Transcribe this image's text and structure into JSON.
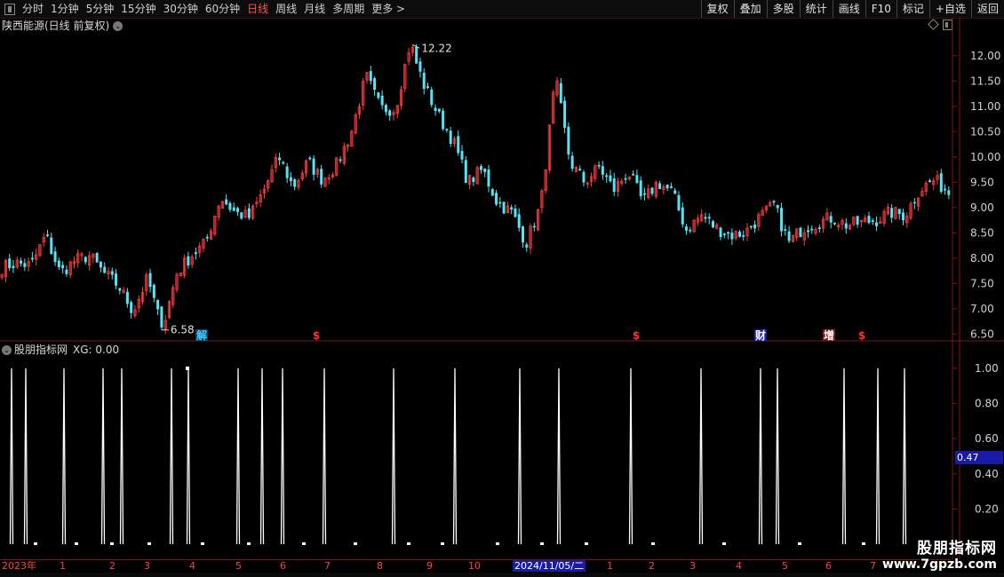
{
  "toolbar": {
    "periods": [
      "分时",
      "1分钟",
      "5分钟",
      "15分钟",
      "30分钟",
      "60分钟",
      "日线",
      "周线",
      "月线",
      "多周期",
      "更多 >"
    ],
    "active_index": 6,
    "right_buttons": [
      "复权",
      "叠加",
      "多股",
      "统计",
      "画线",
      "F10",
      "标记",
      "+自选",
      "返回"
    ]
  },
  "main": {
    "title": "陕西能源(日线 前复权)",
    "high_label": "12.22",
    "low_label": "6.58",
    "y_ticks": [
      "12.00",
      "11.50",
      "11.00",
      "10.50",
      "10.00",
      "9.50",
      "9.00",
      "8.50",
      "8.00",
      "7.50",
      "7.00",
      "6.50"
    ],
    "markers": [
      {
        "text": "解",
        "color": "#40c8ff",
        "bg": "#104060"
      },
      {
        "text": "$",
        "color": "#ff3030",
        "bg": ""
      },
      {
        "text": "$",
        "color": "#ff3030",
        "bg": ""
      },
      {
        "text": "财",
        "color": "#ffffff",
        "bg": "#1a1aa8"
      },
      {
        "text": "增",
        "color": "#ffffff",
        "bg": "#801818"
      },
      {
        "text": "$",
        "color": "#ff3030",
        "bg": ""
      }
    ],
    "colors": {
      "up": "#ff3c3c",
      "down": "#54e4f4",
      "axis": "#8a1010"
    }
  },
  "chart_data": [
    {
      "type": "candlestick",
      "title": "陕西能源(日线 前复权)",
      "ylim": [
        6.4,
        12.4
      ],
      "annotations": {
        "high": 12.22,
        "low": 6.58
      },
      "close_path": [
        7.82,
        7.9,
        7.85,
        8.45,
        7.7,
        7.95,
        8.05,
        7.7,
        7.45,
        6.95,
        7.6,
        6.58,
        7.7,
        8.05,
        8.3,
        9.2,
        8.9,
        8.8,
        9.35,
        10.0,
        9.4,
        9.9,
        9.55,
        9.85,
        10.5,
        11.6,
        10.95,
        10.95,
        12.22,
        11.4,
        10.8,
        10.3,
        9.5,
        9.75,
        9.1,
        8.9,
        8.3,
        9.05,
        11.55,
        9.9,
        9.5,
        9.8,
        9.35,
        9.7,
        9.1,
        9.5,
        9.3,
        8.55,
        8.85,
        8.6,
        8.45,
        8.5,
        8.8,
        9.05,
        8.3,
        8.6,
        8.7,
        8.8,
        8.65,
        8.7,
        8.75,
        8.9,
        8.85,
        9.35,
        9.55,
        9.3
      ]
    },
    {
      "type": "line",
      "title": "股朋指标网 XG",
      "ylim": [
        0,
        1.05
      ],
      "current_value": 0.0,
      "cursor_value": 0.47,
      "spike_count": 33,
      "baseline": 0.0,
      "peak": 1.0
    }
  ],
  "sub": {
    "title": "股朋指标网",
    "xg_text": "XG: 0.00",
    "y_ticks": [
      "1.00",
      "0.80",
      "0.60",
      "0.40",
      "0.20"
    ],
    "cursor_value": "0.47"
  },
  "date_axis": {
    "ticks": [
      "2023年",
      "1",
      "2",
      "3",
      "4",
      "5",
      "6",
      "7",
      "8",
      "9",
      "10",
      "1",
      "2",
      "3",
      "4",
      "5",
      "6",
      "7"
    ],
    "cursor_date": "2024/11/05/二"
  },
  "watermark": {
    "title": "股朋指标网",
    "url": "www.7gpzb.com"
  }
}
